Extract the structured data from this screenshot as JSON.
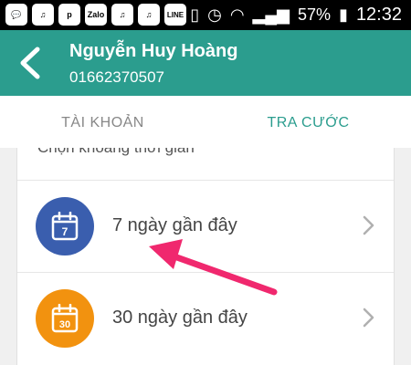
{
  "status_bar": {
    "app_icons": [
      "💬",
      "♫",
      "p",
      "Zalo",
      "♫",
      "♫",
      "LINE"
    ],
    "battery_percent": "57%",
    "time": "12:32"
  },
  "header": {
    "name": "Nguyễn Huy Hoàng",
    "phone": "01662370507"
  },
  "tabs": [
    {
      "label": "TÀI KHOẢN",
      "selected": false
    },
    {
      "label": "TRA CƯỚC",
      "selected": true
    }
  ],
  "section": {
    "label": "Chọn khoảng thời gian"
  },
  "options": [
    {
      "label": "7 ngày gần đây",
      "icon_text": "7",
      "icon": "calendar-icon"
    },
    {
      "label": "30 ngày gần đây",
      "icon_text": "30",
      "icon": "calendar-icon"
    }
  ],
  "colors": {
    "header": "#2b9d8e",
    "tab_indicator": "#f0a030",
    "icon_blue": "#3a5eae",
    "icon_orange": "#f2920f",
    "annotation": "#f0286e"
  }
}
